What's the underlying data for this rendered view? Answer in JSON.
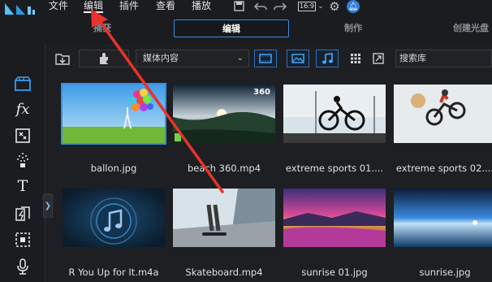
{
  "menu": {
    "items": [
      {
        "label": "文件"
      },
      {
        "label": "编辑"
      },
      {
        "label": "插件"
      },
      {
        "label": "查看"
      },
      {
        "label": "播放"
      }
    ],
    "aspect_ratio": "16:9"
  },
  "modes": {
    "tabs": [
      {
        "label": "捕获"
      },
      {
        "label": "编辑"
      },
      {
        "label": "制作"
      },
      {
        "label": "创建光盘"
      }
    ]
  },
  "library": {
    "media_select": "媒体内容",
    "search_placeholder": "搜索库"
  },
  "media": [
    {
      "name": "ballon.jpg"
    },
    {
      "name": "beach 360.mp4",
      "badge": "360"
    },
    {
      "name": "extreme sports 01...."
    },
    {
      "name": "extreme sports 02...."
    },
    {
      "name": "R You Up for It.m4a"
    },
    {
      "name": "Skateboard.mp4"
    },
    {
      "name": "sunrise 01.jpg"
    },
    {
      "name": "sunrise.jpg"
    }
  ],
  "colors": {
    "accent": "#3a8dde",
    "annotation_arrow": "#e8322b"
  }
}
